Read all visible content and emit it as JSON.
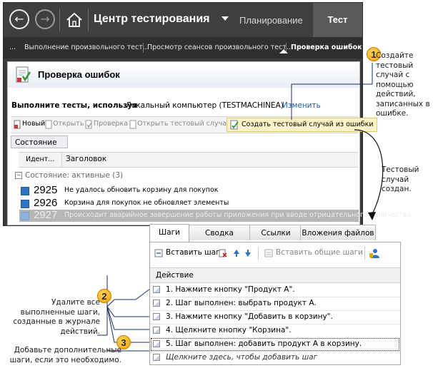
{
  "topbar": {
    "back_icon": "back-arrow-icon",
    "forward_icon": "forward-arrow-icon",
    "home_icon": "home-icon",
    "app_title": "Центр тестирования",
    "tabs": [
      "Планирование",
      "Тест"
    ],
    "active_tab": "Тест"
  },
  "breadcrumbs": {
    "more": "...",
    "items": [
      "Выполнение произвольного тест...",
      "Просмотр сеансов произвольного тест...",
      "Проверка ошибок"
    ]
  },
  "pane": {
    "title": "Проверка ошибок",
    "run_label": "Выполните тесты, используя",
    "run_value": "Локальный компьютер (TESTMACHINEA)",
    "change_link": "Изменить"
  },
  "toolbar": {
    "new": "Новый",
    "open": "Открыть",
    "verify": "Проверка",
    "open_test_case": "Открыть тестовый случай",
    "create_test_case": "Создать тестовый случай из ошибки"
  },
  "grid": {
    "group_column": "Состояние",
    "columns": [
      "Идент...",
      "Заголовок"
    ],
    "group_row": "Состояние: активные (3)",
    "rows": [
      {
        "id": "2925",
        "title": "Не удалось обновить корзину для покупок"
      },
      {
        "id": "2926",
        "title": "Корзина для покупок не обновляет элементы"
      },
      {
        "id": "2927",
        "title": "Происходит аварийное завершение работы приложения при вводе отрицательного количества"
      }
    ]
  },
  "callouts": {
    "c1_num": "1",
    "c1_text": "Создайте тестовый случай с помощью действий, записанных в ошибке.",
    "created_text": "Тестовый случай создан.",
    "c2_num": "2",
    "c2_text": "Удалите все выполненные шаги, созданные в журнале действий.",
    "c3_num": "3",
    "c3_text": "Добавьте дополнительные шаги, если это необходимо."
  },
  "bottom_tabs": [
    "Шаги",
    "Сводка",
    "Ссылки",
    "Вложения файлов"
  ],
  "steps": {
    "insert_step": "Вставить шаг",
    "insert_shared": "Вставить общие шаги",
    "column": "Действие",
    "rows": [
      "1. Нажмите кнопку \"Продукт А\".",
      "2. Шаг выполнен: выбрать продукт А.",
      "3. Нажмите кнопку \"Добавить в корзину\".",
      "4. Щелкните кнопку \"Корзина\".",
      "5. Шаг выполнен: добавить продукт А в корзину."
    ],
    "add_hint": "Щелкните здесь, чтобы добавить шаг"
  },
  "colors": {
    "topbar_bg": "#3f3f3f",
    "callout_orange": "#f0a000",
    "link_blue": "#1a5fb4",
    "work_item_blue": "#2f73c8"
  }
}
